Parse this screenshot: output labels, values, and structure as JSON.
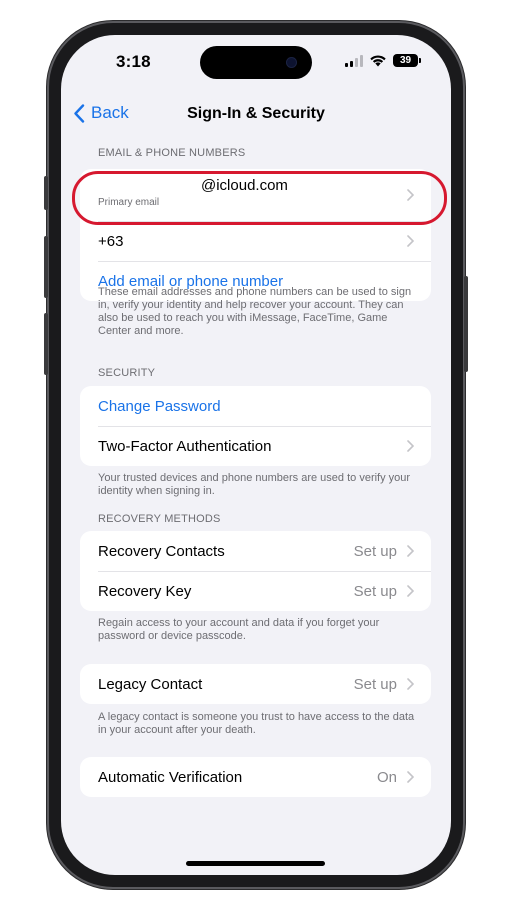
{
  "status_bar": {
    "time": "3:18",
    "battery": "39"
  },
  "nav": {
    "back_label": "Back",
    "title": "Sign-In & Security"
  },
  "email_section": {
    "header": "EMAIL & PHONE NUMBERS",
    "primary_email": "@icloud.com",
    "primary_email_caption": "Primary email",
    "phone": "+63",
    "add_label": "Add email or phone number",
    "footer": "These email addresses and phone numbers can be used to sign in, verify your identity and help recover your account. They can also be used to reach you with iMessage, FaceTime, Game Center and more."
  },
  "security_section": {
    "header": "SECURITY",
    "change_password": "Change Password",
    "two_factor": "Two-Factor Authentication",
    "footer": "Your trusted devices and phone numbers are used to verify your identity when signing in."
  },
  "recovery_section": {
    "header": "RECOVERY METHODS",
    "contacts_label": "Recovery Contacts",
    "contacts_value": "Set up",
    "key_label": "Recovery Key",
    "key_value": "Set up",
    "footer": "Regain access to your account and data if you forget your password or device passcode."
  },
  "legacy_section": {
    "label": "Legacy Contact",
    "value": "Set up",
    "footer": "A legacy contact is someone you trust to have access to the data in your account after your death."
  },
  "auto_verification": {
    "label": "Automatic Verification",
    "value": "On"
  },
  "colors": {
    "accent": "#1a73e8",
    "highlight": "#d6182f",
    "background": "#f2f2f7"
  }
}
